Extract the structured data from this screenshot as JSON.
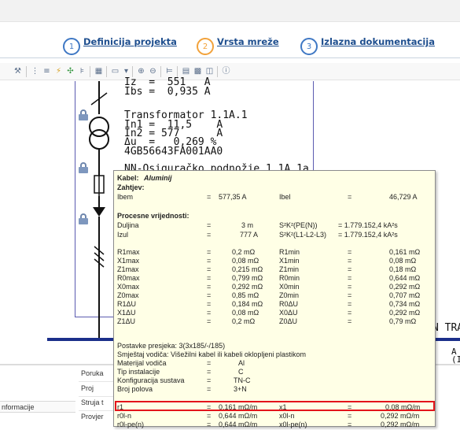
{
  "steps": [
    {
      "num": "1",
      "label": "Definicija projekta"
    },
    {
      "num": "2",
      "label": "Vrsta mreže"
    },
    {
      "num": "3",
      "label": "Izlazna dokumentacija"
    }
  ],
  "toolbar": {
    "icons": [
      "wrench-icon",
      "tree-icon",
      "list-icon",
      "plug-icon",
      "node-icon",
      "arrange-icon",
      "frame-icon",
      "report-icon",
      "dropdown-icon",
      "zoom-in-icon",
      "zoom-out-icon",
      "align-icon",
      "table-icon",
      "grid-icon",
      "columns-icon",
      "info-icon"
    ]
  },
  "diagram": {
    "top_line1": "Iz  =  551   A",
    "top_line2": "Ibs =  0,935 A",
    "transformer_name": "Transformator 1.1A.1",
    "transformer_in1": "In1 =  11,5    A",
    "transformer_in2": "In2 = 577      A",
    "transformer_du": "Δu  =   0,269 %",
    "transformer_code": "4GB56643FA001AA0",
    "fuse_name": "NN-Osiguračko podnožje 1.1A.1a",
    "right_label": "N TRA",
    "right_a": "A",
    "right_b": "(I"
  },
  "tooltip": {
    "kabel_label": "Kabel:",
    "kabel_value": "Aluminij",
    "zahtjevi_label": "Zahtjev:",
    "ibem_label": "Ibem",
    "ibem_eq": "=",
    "ibem_value": "577,35 A",
    "ibel_label": "Ibel",
    "ibel_eq": "=",
    "ibel_value": "46,729 A",
    "procesne_label": "Procesne vrijednosti:",
    "duljina_label": "Duljina",
    "duljina_value": "3 m",
    "izul_label": "Izul",
    "izul_value": "777 A",
    "s2k2_pe_label": "S²K²(PE(N))",
    "s2k2_pe_value": "= 1.779.152,4 kA²s",
    "s2k2_l_label": "S²K²(L1-L2-L3)",
    "s2k2_l_value": "= 1.779.152,4 kA²s",
    "rows": [
      {
        "l1": "R1max",
        "v1": "0,2 mΩ",
        "l2": "R1min",
        "v2": "0,161 mΩ"
      },
      {
        "l1": "X1max",
        "v1": "0,08 mΩ",
        "l2": "X1min",
        "v2": "0,08 mΩ"
      },
      {
        "l1": "Z1max",
        "v1": "0,215 mΩ",
        "l2": "Z1min",
        "v2": "0,18 mΩ"
      },
      {
        "l1": "R0max",
        "v1": "0,799 mΩ",
        "l2": "R0min",
        "v2": "0,644 mΩ"
      },
      {
        "l1": "X0max",
        "v1": "0,292 mΩ",
        "l2": "X0min",
        "v2": "0,292 mΩ"
      },
      {
        "l1": "Z0max",
        "v1": "0,85 mΩ",
        "l2": "Z0min",
        "v2": "0,707 mΩ"
      },
      {
        "l1": "R1ΔU",
        "v1": "0,184 mΩ",
        "l2": "R0ΔU",
        "v2": "0,734 mΩ"
      },
      {
        "l1": "X1ΔU",
        "v1": "0,08 mΩ",
        "l2": "X0ΔU",
        "v2": "0,292 mΩ"
      },
      {
        "l1": "Z1ΔU",
        "v1": "0,2 mΩ",
        "l2": "Z0ΔU",
        "v2": "0,79 mΩ"
      }
    ],
    "postavke": "Postavke presjeka: 3(3x185/-/185)",
    "smjestaj": "Smještaj vodiča: Višežilni kabel ili kabeli oklopljeni plastikom",
    "materijal_label": "Materijal vodiča",
    "materijal_value": "Al",
    "tip_label": "Tip instalacije",
    "tip_value": "C",
    "konf_label": "Konfiguracija sustava",
    "konf_value": "TN-C",
    "broj_label": "Broj polova",
    "broj_value": "3+N",
    "r1_label": "r1",
    "r1_value": "0,161 mΩ/m",
    "x1_label": "x1",
    "x1_value": "0,08 mΩ/m",
    "r0n_label": "r0l-n",
    "r0n_value": "0,644 mΩ/m",
    "x0n_label": "x0l-n",
    "x0n_value": "0,292 mΩ/m",
    "r0pe_label": "r0l-pe(n)",
    "r0pe_value": "0,644 mΩ/m",
    "x0pe_label": "x0l-pe(n)",
    "x0pe_value": "0,292 mΩ/m",
    "eq": "="
  },
  "bottom": {
    "left_label": "nformacije",
    "items": [
      "Poruka",
      "Proj",
      "Struja t",
      "Provjer"
    ]
  }
}
